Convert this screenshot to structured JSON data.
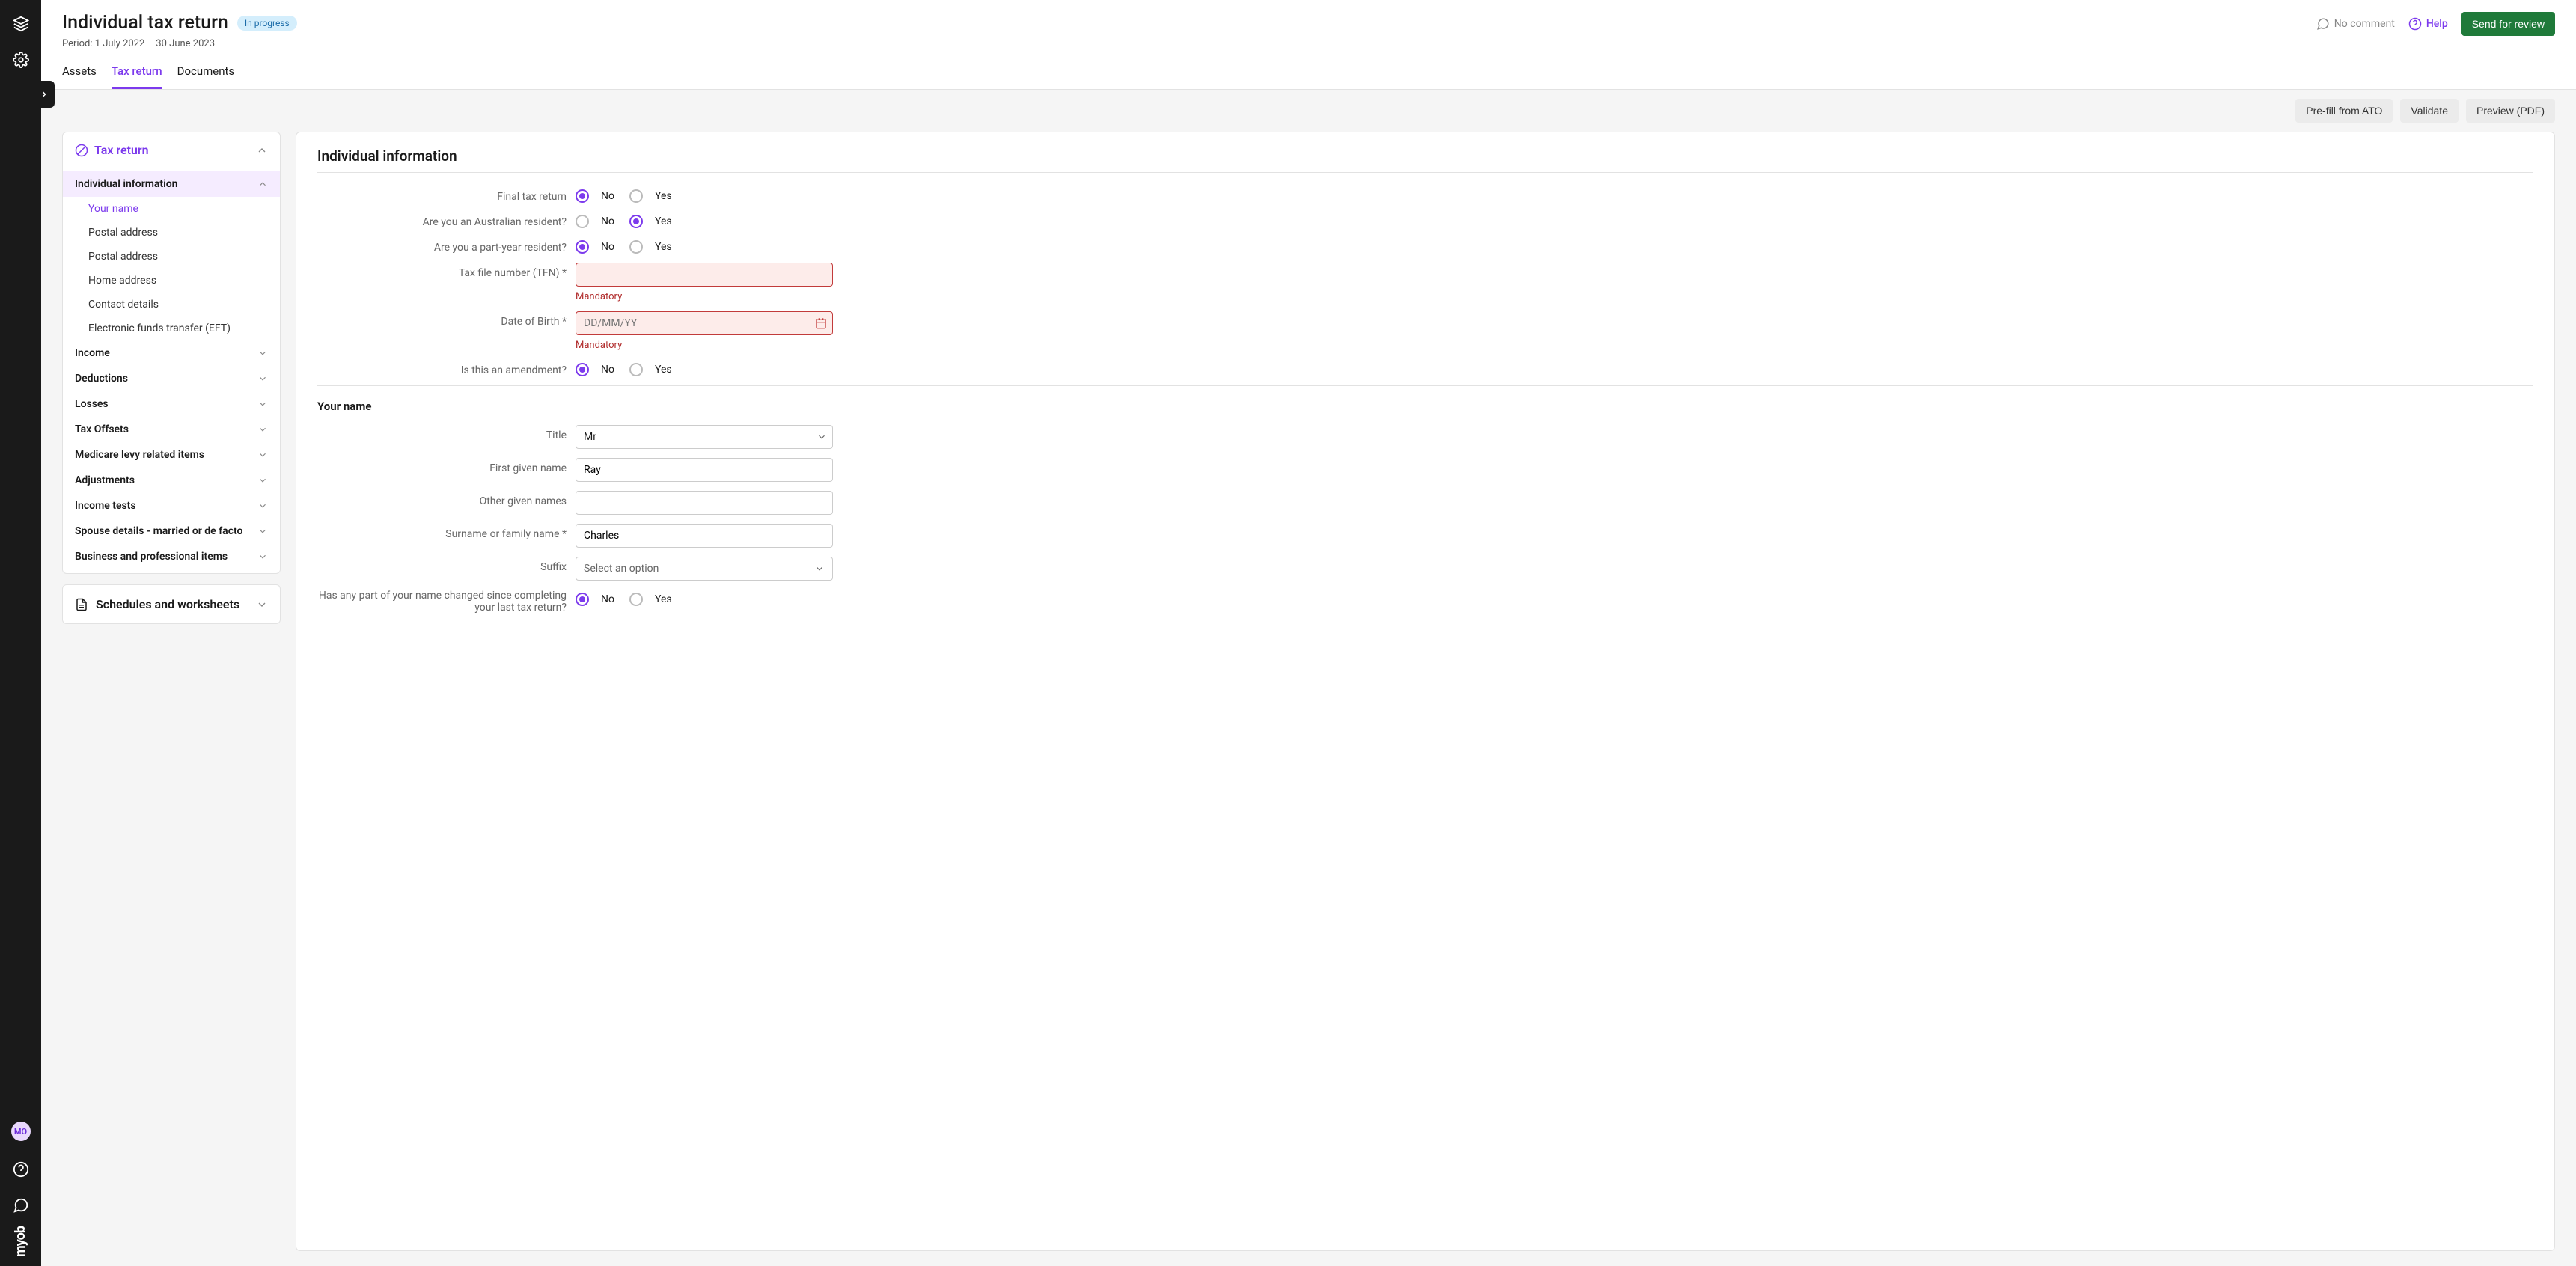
{
  "header": {
    "title": "Individual tax return",
    "status": "In progress",
    "period_label": "Period: 1 July 2022 – 30 June 2023",
    "no_comment": "No comment",
    "help": "Help",
    "send_for_review": "Send for review"
  },
  "tabs": {
    "assets": "Assets",
    "tax_return": "Tax return",
    "documents": "Documents"
  },
  "toolbar": {
    "prefill": "Pre-fill from ATO",
    "validate": "Validate",
    "preview": "Preview (PDF)"
  },
  "nav": {
    "tax_return": "Tax return",
    "individual_info": "Individual information",
    "subs": [
      "Your name",
      "Postal address",
      "Postal address",
      "Home address",
      "Contact details",
      "Electronic funds transfer (EFT)"
    ],
    "sections": [
      "Income",
      "Deductions",
      "Losses",
      "Tax Offsets",
      "Medicare levy related items",
      "Adjustments",
      "Income tests",
      "Spouse details - married or de facto",
      "Business and professional items"
    ],
    "schedules": "Schedules and worksheets"
  },
  "form": {
    "heading": "Individual information",
    "radio_no": "No",
    "radio_yes": "Yes",
    "final_tax_return": "Final tax return",
    "aus_resident": "Are you an Australian resident?",
    "part_year": "Are you a part-year resident?",
    "tfn_label": "Tax file number (TFN) *",
    "mandatory": "Mandatory",
    "dob_label": "Date of Birth *",
    "dob_placeholder": "DD/MM/YY",
    "amendment": "Is this an amendment?",
    "your_name_heading": "Your name",
    "title_label": "Title",
    "title_value": "Mr",
    "first_name_label": "First given name",
    "first_name_value": "Ray",
    "other_names_label": "Other given names",
    "other_names_value": "",
    "surname_label": "Surname or family name *",
    "surname_value": "Charles",
    "suffix_label": "Suffix",
    "suffix_placeholder": "Select an option",
    "name_changed": "Has any part of your name changed since completing your last tax return?"
  },
  "avatar": "MO"
}
